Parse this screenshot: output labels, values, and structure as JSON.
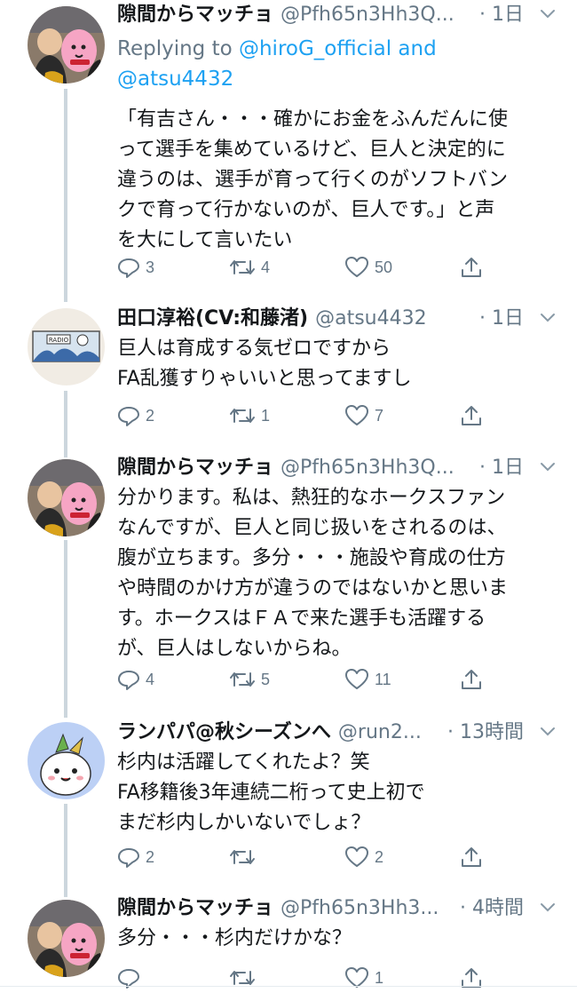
{
  "tweets": [
    {
      "author": "隙間からマッチョ",
      "handle": "@Pfh65n3Hh3Q...",
      "time": "· 1日",
      "reply_prefix": "Replying to ",
      "reply_users": [
        "@hiroG_official",
        " and",
        "@atsu4432"
      ],
      "lines": [
        "「有吉さん・・・確かにお金をふんだんに使",
        "って選手を集めているけど、巨人と決定的に",
        "違うのは、選手が育って行くのがソフトバン",
        "クで育って行かないのが、巨人です。」と声",
        "を大にして言いたい"
      ],
      "replies": "3",
      "retweets": "4",
      "likes": "50",
      "avatar_icon": "macho-avatar-icon"
    },
    {
      "author": "田口淳裕(CV:和藤渚)",
      "handle": "@atsu4432",
      "time": "· 1日",
      "lines": [
        "巨人は育成する気ゼロですから",
        "FA乱獲すりゃいいと思ってますし"
      ],
      "replies": "2",
      "retweets": "1",
      "likes": "7",
      "avatar_icon": "radio-banner-avatar-icon"
    },
    {
      "author": "隙間からマッチョ",
      "handle": "@Pfh65n3Hh3Q...",
      "time": "· 1日",
      "lines": [
        "分かります。私は、熱狂的なホークスファン",
        "なんですが、巨人と同じ扱いをされるのは、",
        "腹が立ちます。多分・・・施設や育成の仕方",
        "や時間のかけ方が違うのではないかと思いま",
        "す。ホークスはＦＡで来た選手も活躍する",
        "が、巨人はしないからね。"
      ],
      "replies": "4",
      "retweets": "5",
      "likes": "11",
      "avatar_icon": "macho-avatar-icon"
    },
    {
      "author": "ランパパ@秋シーズンへ",
      "handle": "@run2...",
      "time": "· 13時間",
      "lines": [
        "杉内は活躍してくれたよ？笑",
        "FA移籍後3年連続二桁って史上初で",
        "まだ杉内しかいないでしょ？"
      ],
      "replies": "2",
      "retweets": "",
      "likes": "2",
      "avatar_icon": "mascot-avatar-icon"
    },
    {
      "author": "隙間からマッチョ",
      "handle": "@Pfh65n3Hh3...",
      "time": "· 4時間",
      "lines": [
        "多分・・・杉内だけかな？"
      ],
      "replies": "",
      "retweets": "",
      "likes": "1",
      "avatar_icon": "macho-avatar-icon"
    }
  ],
  "icons": {
    "reply": "reply-icon",
    "retweet": "retweet-icon",
    "like": "heart-icon",
    "share": "share-icon",
    "more": "chevron-down-icon"
  },
  "colors": {
    "link": "#1da1f2",
    "muted": "#657786",
    "thread_line": "#ccd6dd",
    "text": "#14171a"
  }
}
